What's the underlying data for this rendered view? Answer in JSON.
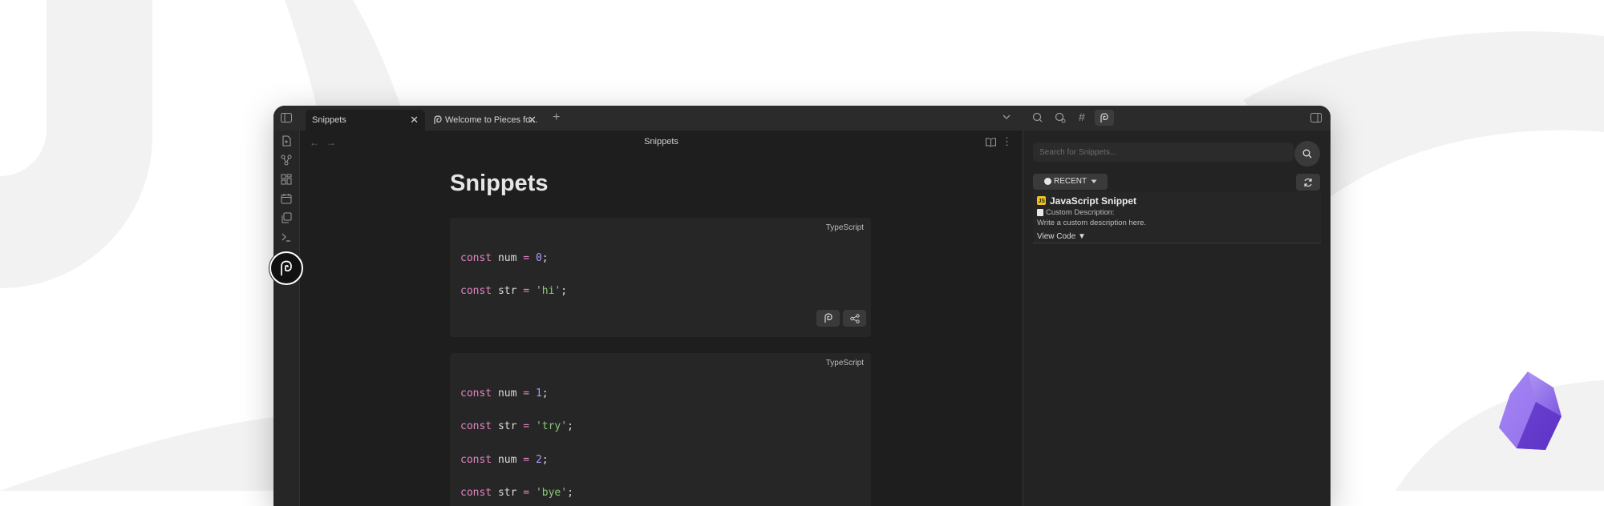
{
  "tabs": [
    {
      "label": "Snippets",
      "active": true
    },
    {
      "label": "Welcome to Pieces fo...",
      "active": false
    }
  ],
  "main": {
    "header_title": "Snippets",
    "page_title": "Snippets",
    "code_blocks": [
      {
        "language": "TypeScript",
        "lines": [
          {
            "kw": "const",
            "name": " num ",
            "op": "=",
            "value": "0",
            "value_type": "num"
          },
          {
            "kw": "const",
            "name": " str ",
            "op": "=",
            "value": "'hi'",
            "value_type": "str"
          }
        ]
      },
      {
        "language": "TypeScript",
        "lines": [
          {
            "kw": "const",
            "name": " num ",
            "op": "=",
            "value": "1",
            "value_type": "num"
          },
          {
            "kw": "const",
            "name": " str ",
            "op": "=",
            "value": "'try'",
            "value_type": "str"
          },
          {
            "kw": "const",
            "name": " num ",
            "op": "=",
            "value": "2",
            "value_type": "num"
          },
          {
            "kw": "const",
            "name": " str ",
            "op": "=",
            "value": "'bye'",
            "value_type": "str"
          }
        ]
      }
    ]
  },
  "right_panel": {
    "search_placeholder": "Search for Snippets...",
    "filter_label": "RECENT",
    "snippet": {
      "badge": "JS",
      "title": "JavaScript Snippet",
      "description_label": "Custom Description:",
      "description": "Write a custom description here.",
      "view_code_label": "View Code ▼"
    }
  },
  "colors": {
    "window_bg": "#1e1e1e",
    "titlebar_bg": "#2b2b2b",
    "keyword": "#e386c4",
    "number": "#a99cf6",
    "string": "#8cc97a",
    "accent_purple": "#8b5cf6"
  }
}
